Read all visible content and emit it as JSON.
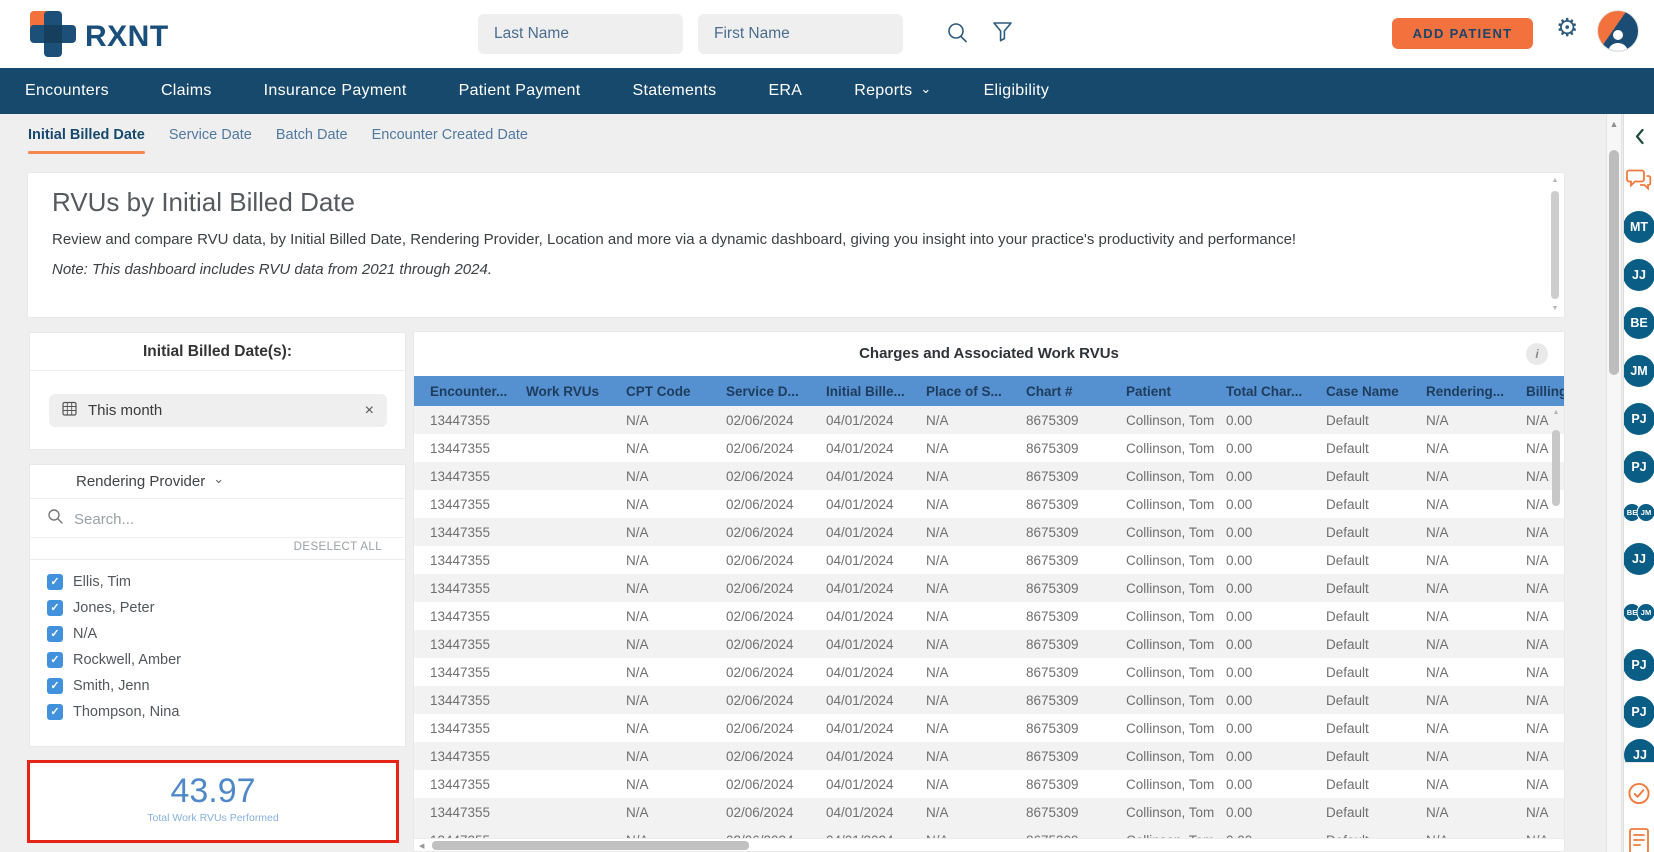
{
  "topbar": {
    "brand": "RXNT",
    "last_name_placeholder": "Last Name",
    "first_name_placeholder": "First Name",
    "add_patient_label": "ADD PATIENT"
  },
  "nav": {
    "items": [
      {
        "label": "Encounters"
      },
      {
        "label": "Claims"
      },
      {
        "label": "Insurance Payment"
      },
      {
        "label": "Patient Payment"
      },
      {
        "label": "Statements"
      },
      {
        "label": "ERA"
      },
      {
        "label": "Reports",
        "has_caret": true
      },
      {
        "label": "Eligibility"
      }
    ]
  },
  "tabs": {
    "items": [
      "Initial Billed Date",
      "Service Date",
      "Batch Date",
      "Encounter Created Date"
    ],
    "active_index": 0
  },
  "overview": {
    "title": "RVUs by Initial Billed Date",
    "description": "Review and compare RVU data, by Initial Billed Date, Rendering Provider, Location and more via a dynamic dashboard, giving you insight into your practice's productivity and performance!",
    "note": "Note: This dashboard includes RVU data from 2021 through 2024."
  },
  "date_filter": {
    "title": "Initial Billed Date(s):",
    "value": "This month"
  },
  "provider_filter": {
    "title": "Rendering Provider",
    "search_placeholder": "Search...",
    "deselect_all_label": "DESELECT ALL",
    "providers": [
      {
        "name": "Ellis, Tim",
        "checked": true
      },
      {
        "name": "Jones, Peter",
        "checked": true
      },
      {
        "name": "N/A",
        "checked": true
      },
      {
        "name": "Rockwell, Amber",
        "checked": true
      },
      {
        "name": "Smith, Jenn",
        "checked": true
      },
      {
        "name": "Thompson, Nina",
        "checked": true
      }
    ]
  },
  "total_card": {
    "value": "43.97",
    "label": "Total Work RVUs Performed"
  },
  "table": {
    "title": "Charges and Associated Work RVUs",
    "columns": [
      "Encounter...",
      "Work RVUs",
      "CPT Code",
      "Service D...",
      "Initial Bille...",
      "Place of S...",
      "Chart #",
      "Patient",
      "Total Char...",
      "Case Name",
      "Rendering...",
      "Billing..."
    ],
    "row_values": [
      "13447355",
      "",
      "N/A",
      "02/06/2024",
      "04/01/2024",
      "N/A",
      "8675309",
      "Collinson, Tom",
      "0.00",
      "Default",
      "N/A",
      "N/A"
    ],
    "visible_row_count": 15,
    "has_partial_row": true
  },
  "right_rail": {
    "items": [
      {
        "type": "collapse-chevron"
      },
      {
        "type": "chat"
      },
      {
        "type": "avatar",
        "initials": "MT"
      },
      {
        "type": "avatar",
        "initials": "JJ"
      },
      {
        "type": "avatar",
        "initials": "BE"
      },
      {
        "type": "avatar",
        "initials": "JM"
      },
      {
        "type": "avatar",
        "initials": "PJ"
      },
      {
        "type": "avatar",
        "initials": "PJ"
      },
      {
        "type": "avatar-pair",
        "initials": [
          "BE",
          "JM"
        ]
      },
      {
        "type": "avatar",
        "initials": "JJ"
      },
      {
        "type": "avatar-pair",
        "initials": [
          "BE",
          "JM"
        ]
      },
      {
        "type": "avatar",
        "initials": "PJ"
      },
      {
        "type": "avatar",
        "initials": "PJ"
      },
      {
        "type": "avatar-partial",
        "initials": "JJ"
      },
      {
        "type": "check"
      },
      {
        "type": "doc"
      }
    ]
  },
  "colors": {
    "nav_navy": "#17496d",
    "brand_orange": "#f2713c",
    "table_header_blue": "#5590d1",
    "checkbox_blue": "#4191dc",
    "total_blue": "#4f88c9",
    "highlight_red": "#e52317",
    "avatar_teal": "#0a5d85"
  }
}
